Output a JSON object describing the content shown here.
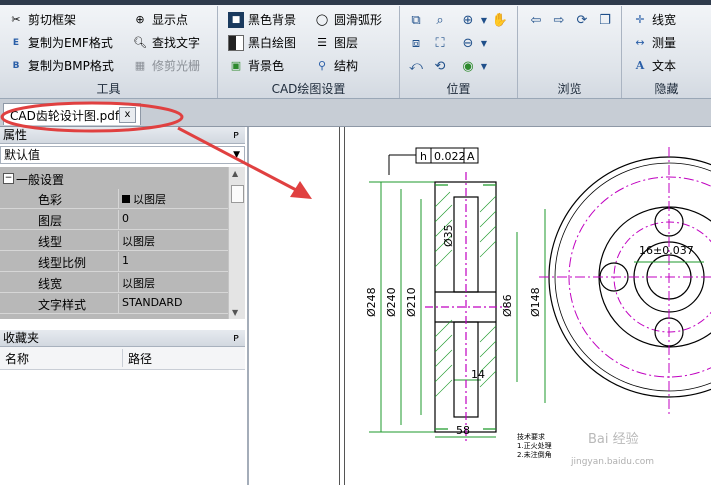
{
  "ribbon": {
    "tools": {
      "title": "工具",
      "items": [
        "剪切框架",
        "复制为EMF格式",
        "复制为BMP格式",
        "显示点",
        "查找文字",
        "修剪光栅"
      ]
    },
    "cad_settings": {
      "title": "CAD绘图设置",
      "items": [
        "黑色背景",
        "黑白绘图",
        "背景色",
        "圆滑弧形",
        "图层",
        "结构"
      ]
    },
    "position": {
      "title": "位置"
    },
    "browse": {
      "title": "浏览"
    },
    "hide": {
      "title": "隐藏",
      "items": [
        "线宽",
        "测量",
        "文本"
      ]
    }
  },
  "tab": {
    "label": "CAD齿轮设计图.pdf",
    "close": "x"
  },
  "properties": {
    "title": "属性",
    "pin": "ᴘ",
    "combo_value": "默认值",
    "category": "一般设置",
    "category_toggle": "−",
    "rows": [
      {
        "key": "色彩",
        "value": "以图层"
      },
      {
        "key": "图层",
        "value": "0"
      },
      {
        "key": "线型",
        "value": "以图层"
      },
      {
        "key": "线型比例",
        "value": "1"
      },
      {
        "key": "线宽",
        "value": "以图层"
      },
      {
        "key": "文字样式",
        "value": "STANDARD"
      }
    ]
  },
  "favorites": {
    "title": "收藏夹",
    "pin": "ᴘ",
    "columns": [
      "名称",
      "路径"
    ]
  },
  "drawing": {
    "tolerance_box": [
      "h",
      "0.022",
      "A"
    ],
    "dims": [
      "Ø248",
      "Ø240",
      "Ø210",
      "Ø35",
      "Ø86",
      "Ø148",
      "14",
      "58",
      "16±0.037"
    ],
    "notes": [
      "技术要求",
      "1.正火处理",
      "2.未注倒角"
    ]
  },
  "watermark": {
    "text": "Bai 经验",
    "url": "jingyan.baidu.com"
  },
  "colors": {
    "annotation": "#e04040",
    "dim_green": "#1e9a2b",
    "cad_magenta": "#c000c0"
  }
}
